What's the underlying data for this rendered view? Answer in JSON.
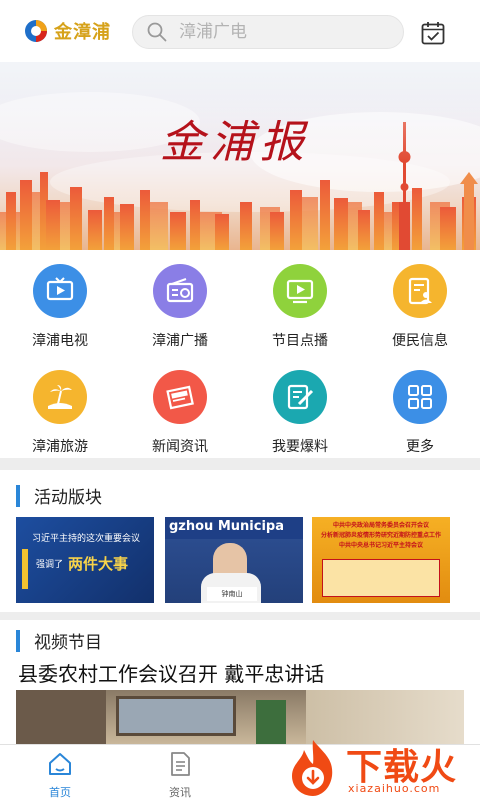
{
  "header": {
    "app_name": "金漳浦",
    "search_placeholder": "漳浦广电"
  },
  "banner": {
    "title": "金浦报"
  },
  "grid": [
    {
      "label": "漳浦电视",
      "icon": "tv-icon",
      "color": "#3c8fe6"
    },
    {
      "label": "漳浦广播",
      "icon": "radio-icon",
      "color": "#8a7ee6"
    },
    {
      "label": "节目点播",
      "icon": "video-play-icon",
      "color": "#8fd23c"
    },
    {
      "label": "便民信息",
      "icon": "document-person-icon",
      "color": "#f5b52e"
    },
    {
      "label": "漳浦旅游",
      "icon": "beach-palm-icon",
      "color": "#f5b52e"
    },
    {
      "label": "新闻资讯",
      "icon": "news-icon",
      "color": "#f25848"
    },
    {
      "label": "我要爆料",
      "icon": "edit-note-icon",
      "color": "#1ba8b0"
    },
    {
      "label": "更多",
      "icon": "grid-more-icon",
      "color": "#3c8fe6"
    }
  ],
  "sections": {
    "activity_title": "活动版块",
    "video_title": "视频节目"
  },
  "activity_thumbs": {
    "thumb1_line1": "习近平主持的这次重要会议",
    "thumb1_line2_a": "强调了",
    "thumb1_line2_b": "两件大事",
    "thumb2_banner": "gzhou Municipa",
    "thumb2_plate": "钟南山",
    "thumb3_line1": "中共中央政治局常务委员会召开会议",
    "thumb3_line2": "分析新冠肺炎疫情形势研究近期防控重点工作",
    "thumb3_line3": "中共中央总书记习近平主持会议"
  },
  "video": {
    "headline": "县委农村工作会议召开 戴平忠讲话"
  },
  "bottom_nav": [
    {
      "label": "首页",
      "icon": "home-icon",
      "active": true
    },
    {
      "label": "资讯",
      "icon": "document-icon",
      "active": false
    }
  ],
  "watermark": {
    "text": "下载火",
    "url": "xiazaihuo.com"
  },
  "colors": {
    "accent": "#2a86d8",
    "logo_gold": "#d6a21a",
    "watermark": "#f04a14"
  }
}
